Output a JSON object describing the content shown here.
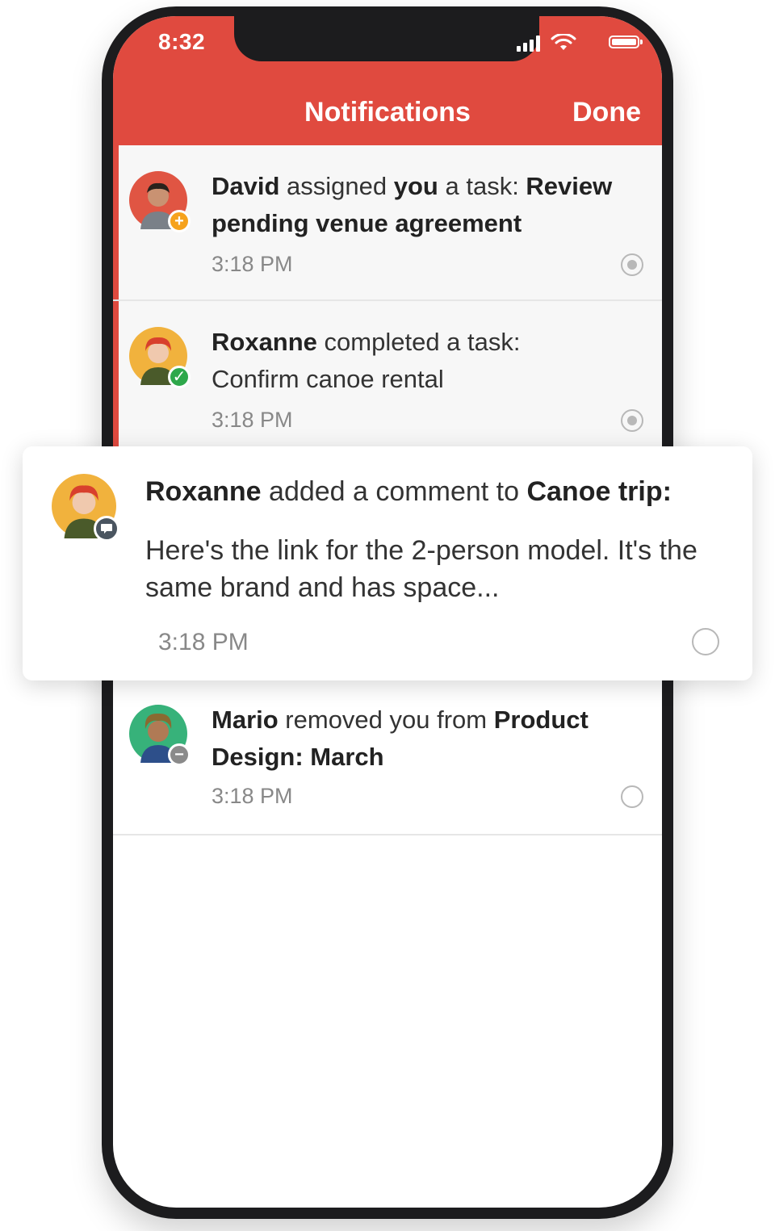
{
  "status_bar": {
    "time": "8:32"
  },
  "header": {
    "title": "Notifications",
    "done_label": "Done"
  },
  "notifications": [
    {
      "actor": "David",
      "verb": " assigned ",
      "object": "you",
      "middle": " a task: ",
      "target": "Review pending venue agreement",
      "time": "3:18 PM",
      "badge_icon": "plus-icon",
      "badge_color": "#f6a21c",
      "read_state": "unread"
    },
    {
      "actor": "Roxanne",
      "verb": " completed a task:",
      "detail": "Confirm canoe rental",
      "time": "3:18 PM",
      "badge_icon": "check-icon",
      "badge_color": "#2ea84b",
      "read_state": "unread"
    },
    {
      "actor": "Roxanne",
      "verb": " added a comment to ",
      "target": "Canoe trip:",
      "comment": "Here's the link for the 2-person model. It's the same brand and has space...",
      "time": "3:18 PM",
      "badge_icon": "comment-icon",
      "badge_color": "#4a5560",
      "read_state": "read"
    },
    {
      "actor": "Mario",
      "verb": " removed you from ",
      "target": "Product Design: March",
      "time": "3:18 PM",
      "badge_icon": "minus-icon",
      "badge_color": "#8a8a8a",
      "read_state": "read"
    }
  ],
  "colors": {
    "accent": "#e04a3f"
  }
}
